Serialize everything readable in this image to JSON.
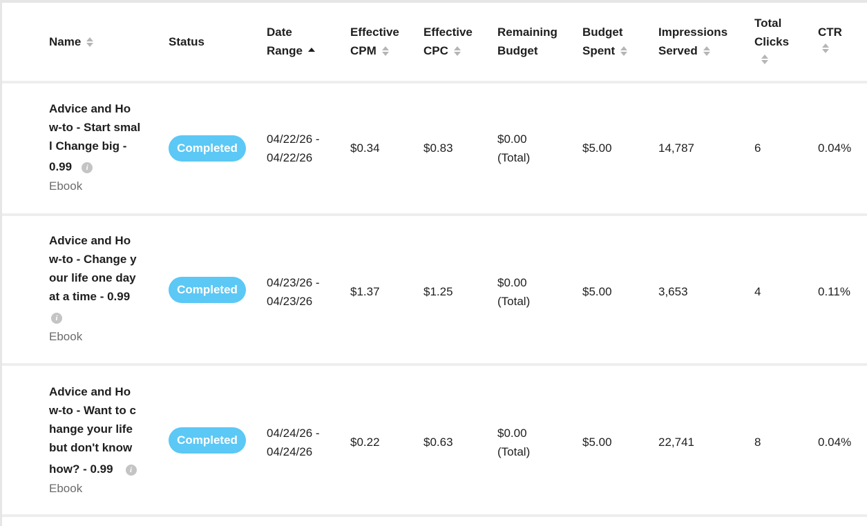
{
  "headers": {
    "name": "Name",
    "status": "Status",
    "date_range": [
      "Date",
      "Range"
    ],
    "effective_cpm": [
      "Effective",
      "CPM"
    ],
    "effective_cpc": [
      "Effective",
      "CPC"
    ],
    "remaining_budget": [
      "Remaining",
      "Budget"
    ],
    "budget_spent": [
      "Budget",
      "Spent"
    ],
    "impressions_served": [
      "Impressions",
      "Served"
    ],
    "total_clicks": [
      "Total",
      "Clicks"
    ],
    "ctr": "CTR"
  },
  "rows": [
    {
      "name_lines": [
        "Advice and Ho",
        "w-to - Start smal",
        "l Change big -",
        "0.99"
      ],
      "format": "Ebook",
      "status": "Completed",
      "date_start": "04/22/26 -",
      "date_end": "04/22/26",
      "effective_cpm": "$0.34",
      "effective_cpc": "$0.83",
      "remaining_amount": "$0.00",
      "remaining_note": "(Total)",
      "budget_spent": "$5.00",
      "impressions": "14,787",
      "clicks": "6",
      "ctr": "0.04%"
    },
    {
      "name_lines": [
        "Advice and Ho",
        "w-to - Change y",
        "our life one day",
        "at a time - 0.99"
      ],
      "format": "Ebook",
      "status": "Completed",
      "date_start": "04/23/26 -",
      "date_end": "04/23/26",
      "effective_cpm": "$1.37",
      "effective_cpc": "$1.25",
      "remaining_amount": "$0.00",
      "remaining_note": "(Total)",
      "budget_spent": "$5.00",
      "impressions": "3,653",
      "clicks": "4",
      "ctr": "0.11%"
    },
    {
      "name_lines": [
        "Advice and Ho",
        "w-to - Want to c",
        "hange your life",
        "but don't know",
        "how? - 0.99"
      ],
      "format": "Ebook",
      "status": "Completed",
      "date_start": "04/24/26 -",
      "date_end": "04/24/26",
      "effective_cpm": "$0.22",
      "effective_cpc": "$0.63",
      "remaining_amount": "$0.00",
      "remaining_note": "(Total)",
      "budget_spent": "$5.00",
      "impressions": "22,741",
      "clicks": "8",
      "ctr": "0.04%"
    }
  ],
  "colors": {
    "status_badge": "#5bc8f5",
    "info_icon": "#c4c4c4",
    "sort_icon": "#b5b5b5"
  },
  "icons": {
    "sort": "sort-icon",
    "sort_ascending": "sort-ascending-icon",
    "info": "info-icon"
  }
}
